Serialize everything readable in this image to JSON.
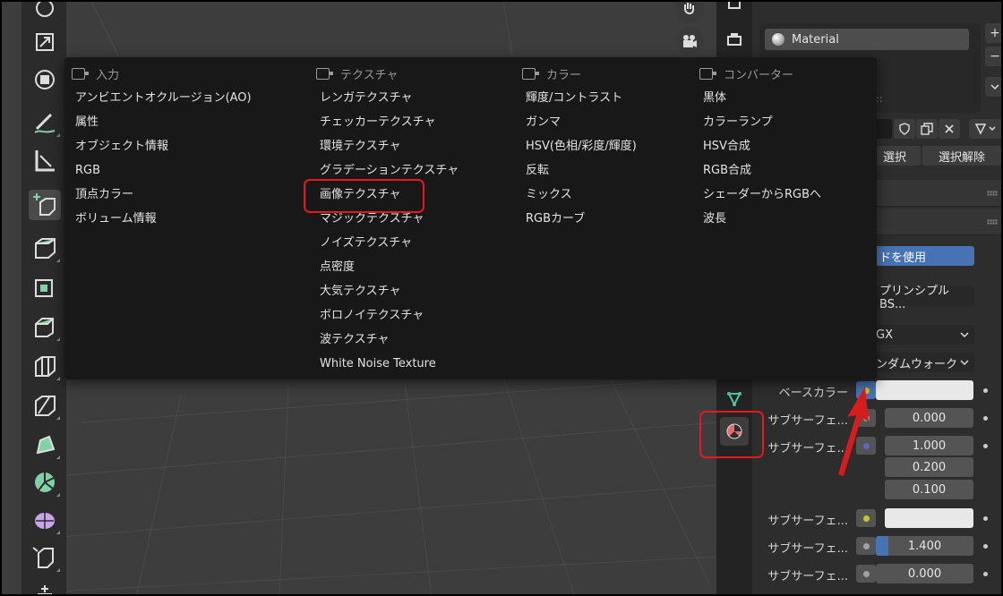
{
  "menu": {
    "columns": [
      {
        "header": "入力",
        "items": [
          "アンビエントオクルージョン(AO)",
          "属性",
          "オブジェクト情報",
          "RGB",
          "頂点カラー",
          "ボリューム情報"
        ]
      },
      {
        "header": "テクスチャ",
        "items": [
          "レンガテクスチャ",
          "チェッカーテクスチャ",
          "環境テクスチャ",
          "グラデーションテクスチャ",
          "画像テクスチャ",
          "マジックテクスチャ",
          "ノイズテクスチャ",
          "点密度",
          "大気テクスチャ",
          "ボロノイテクスチャ",
          "波テクスチャ",
          "White Noise Texture"
        ]
      },
      {
        "header": "カラー",
        "items": [
          "輝度/コントラスト",
          "ガンマ",
          "HSV(色相/彩度/輝度)",
          "反転",
          "ミックス",
          "RGBカーブ"
        ]
      },
      {
        "header": "コンバーター",
        "items": [
          "黒体",
          "カラーランプ",
          "HSV合成",
          "RGB合成",
          "シェーダーからRGBへ",
          "波長"
        ]
      }
    ],
    "highlighted_item": "画像テクスチャ"
  },
  "properties": {
    "material_slot": "Material",
    "slot_dots": "::",
    "select_button": "選択",
    "deselect_button": "選択解除",
    "use_nodes_button": "ドを使用",
    "surface_shader": "プリンシプルBS...",
    "distribution": "GX",
    "subsurface_method": "ンダムウォーク",
    "rows": [
      {
        "label": "ベースカラー",
        "socket_color": "#c7c729",
        "value": ""
      },
      {
        "label": "サブサーフェ...",
        "socket_color": "#a1a1a1",
        "value": "0.000"
      },
      {
        "label": "サブサーフェ...",
        "socket_color": "#6363c7",
        "value": "1.000"
      },
      {
        "label": "",
        "socket_color": "",
        "value": "0.200"
      },
      {
        "label": "",
        "socket_color": "",
        "value": "0.100"
      },
      {
        "label": "サブサーフェ...",
        "socket_color": "#c7c729",
        "value": ""
      },
      {
        "label": "サブサーフェ...",
        "socket_color": "#a1a1a1",
        "value": "1.400"
      },
      {
        "label": "サブサーフェ...",
        "socket_color": "#a1a1a1",
        "value": "0.000"
      }
    ]
  },
  "colors": {
    "accent_blue": "#4772b3",
    "highlight_red": "#e8191e",
    "menu_bg": "#181818",
    "viewport_bg": "#3d3d3d"
  }
}
